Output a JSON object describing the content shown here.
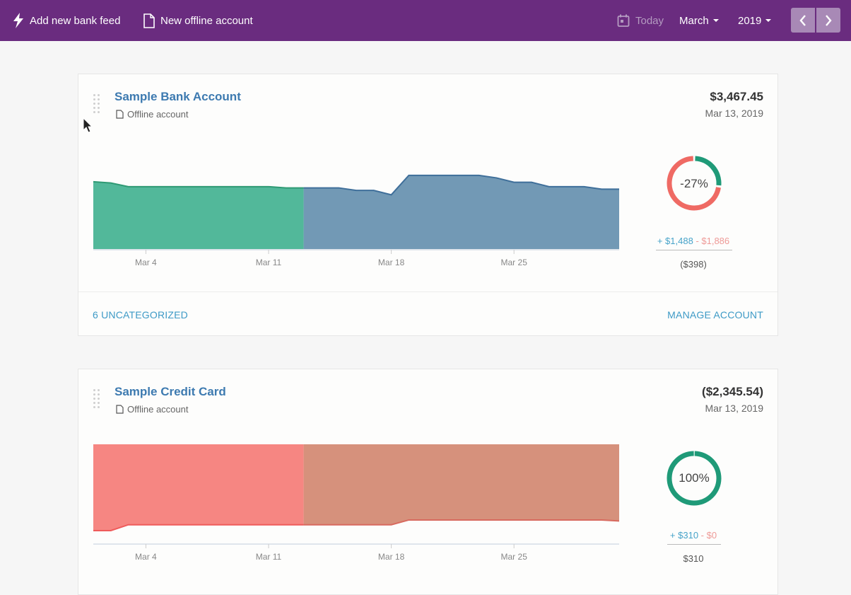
{
  "topbar": {
    "add_feed": {
      "label": "Add new bank feed",
      "icon": "lightning-icon"
    },
    "new_offline": {
      "label": "New offline account",
      "icon": "document-icon"
    },
    "today": {
      "label": "Today",
      "icon": "calendar-icon"
    },
    "month": "March",
    "year": "2019",
    "prev_icon": "chevron-left-icon",
    "next_icon": "chevron-right-icon"
  },
  "colors": {
    "brand": "#6a2c7f",
    "link": "#3d7ab0",
    "positive_past": "#52b89a",
    "positive_future": "#7299b5",
    "negative_past": "#f68682",
    "negative_future": "#d6917c",
    "donut_green": "#1f9a78",
    "donut_red": "#ef6a64"
  },
  "accounts": [
    {
      "name": "Sample Bank Account",
      "type_label": "Offline account",
      "balance": "$3,467.45",
      "date": "Mar 13, 2019",
      "change_pct": "-27%",
      "inflow": "+ $1,488",
      "outflow": "- $1,886",
      "net": "($398)",
      "donut_green_fraction": 0.27,
      "footer_left": "6 UNCATEGORIZED",
      "footer_right": "MANAGE ACCOUNT"
    },
    {
      "name": "Sample Credit Card",
      "type_label": "Offline account",
      "balance": "($2,345.54)",
      "date": "Mar 13, 2019",
      "change_pct": "100%",
      "inflow": "+ $310",
      "outflow": "- $0",
      "net": "$310",
      "donut_green_fraction": 1.0
    }
  ],
  "chart_data": [
    {
      "type": "area",
      "title": "Sample Bank Account balance",
      "x": [
        1,
        2,
        3,
        4,
        5,
        6,
        7,
        8,
        9,
        10,
        11,
        12,
        13,
        14,
        15,
        16,
        17,
        18,
        19,
        20,
        21,
        22,
        23,
        24,
        25,
        26,
        27,
        28,
        29,
        30,
        31
      ],
      "xticks": [
        4,
        11,
        18,
        25
      ],
      "xtick_labels": [
        "Mar 4",
        "Mar 11",
        "Mar 18",
        "Mar 25"
      ],
      "today": 13,
      "values": [
        3740,
        3670,
        3467,
        3467,
        3467,
        3467,
        3467,
        3467,
        3467,
        3467,
        3467,
        3400,
        3400,
        3400,
        3400,
        3260,
        3260,
        3020,
        4090,
        4090,
        4090,
        4090,
        4090,
        3950,
        3710,
        3710,
        3467,
        3467,
        3467,
        3330,
        3330
      ],
      "ylim": [
        0,
        4200
      ],
      "xlabel": "",
      "ylabel": ""
    },
    {
      "type": "area",
      "title": "Sample Credit Card balance",
      "x": [
        1,
        2,
        3,
        4,
        5,
        6,
        7,
        8,
        9,
        10,
        11,
        12,
        13,
        14,
        15,
        16,
        17,
        18,
        19,
        20,
        21,
        22,
        23,
        24,
        25,
        26,
        27,
        28,
        29,
        30,
        31
      ],
      "xticks": [
        4,
        11,
        18,
        25
      ],
      "xtick_labels": [
        "Mar 4",
        "Mar 11",
        "Mar 18",
        "Mar 25"
      ],
      "today": 13,
      "values": [
        -2515,
        -2515,
        -2345,
        -2345,
        -2345,
        -2345,
        -2345,
        -2345,
        -2345,
        -2345,
        -2345,
        -2345,
        -2345,
        -2345,
        -2345,
        -2345,
        -2345,
        -2345,
        -2205,
        -2205,
        -2205,
        -2205,
        -2205,
        -2205,
        -2205,
        -2205,
        -2205,
        -2205,
        -2205,
        -2205,
        -2235
      ],
      "ylim": [
        -4000,
        0
      ],
      "xlabel": "",
      "ylabel": ""
    }
  ]
}
